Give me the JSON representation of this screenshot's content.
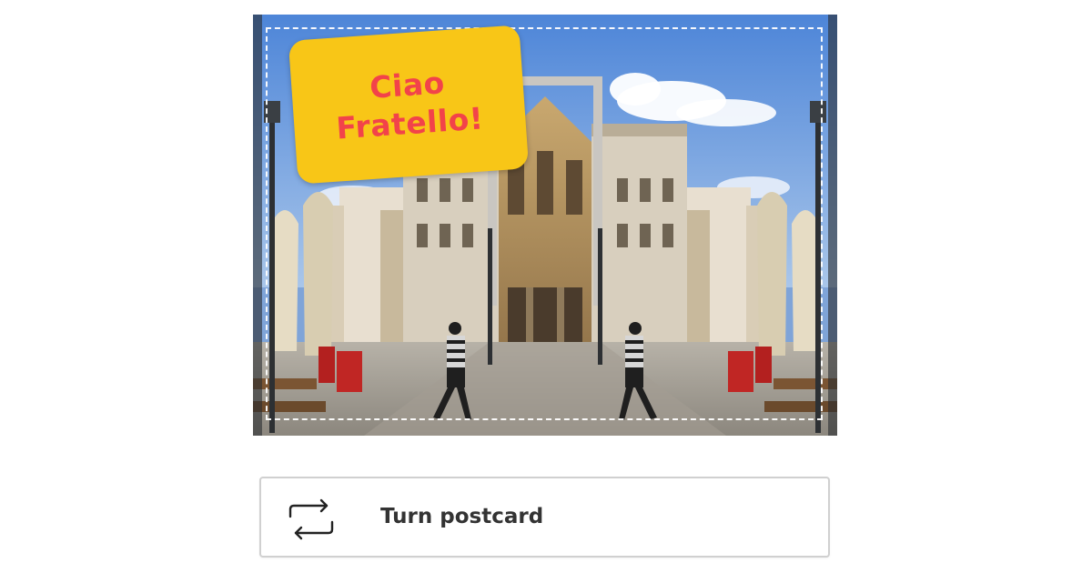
{
  "postcard": {
    "sticker": {
      "line1": "Ciao",
      "line2": "Fratello!",
      "background_color": "#f8c617",
      "text_color": "#f2434a"
    },
    "photo_icon": "mirrored-street-photo"
  },
  "turn_button": {
    "label": "Turn postcard",
    "icon": "swap-arrows-icon"
  }
}
